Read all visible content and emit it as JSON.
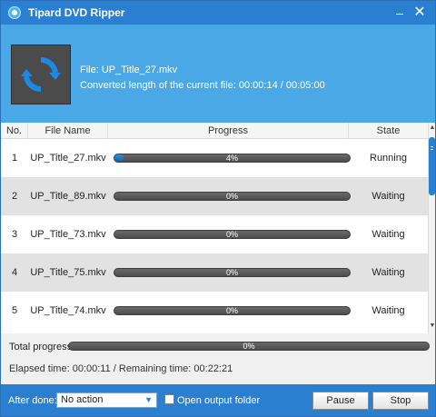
{
  "window": {
    "title": "Tipard DVD Ripper"
  },
  "titlebar": {
    "min_glyph": "–",
    "close_glyph": "✕"
  },
  "current": {
    "file_line": "File: UP_Title_27.mkv",
    "length_line": "Converted length of the current file: 00:00:14 / 00:05:00"
  },
  "table": {
    "headers": {
      "no": "No.",
      "name": "File Name",
      "progress": "Progress",
      "state": "State"
    },
    "rows": [
      {
        "no": "1",
        "name": "UP_Title_27.mkv",
        "progress_text": "4%",
        "progress": 0.04,
        "state": "Running"
      },
      {
        "no": "2",
        "name": "UP_Title_89.mkv",
        "progress_text": "0%",
        "progress": 0,
        "state": "Waiting"
      },
      {
        "no": "3",
        "name": "UP_Title_73.mkv",
        "progress_text": "0%",
        "progress": 0,
        "state": "Waiting"
      },
      {
        "no": "4",
        "name": "UP_Title_75.mkv",
        "progress_text": "0%",
        "progress": 0,
        "state": "Waiting"
      },
      {
        "no": "5",
        "name": "UP_Title_74.mkv",
        "progress_text": "0%",
        "progress": 0,
        "state": "Waiting"
      }
    ]
  },
  "total": {
    "label": "Total progress:",
    "progress_text": "0%",
    "elapsed_text": "Elapsed time: 00:00:11 / Remaining time: 00:22:21"
  },
  "bottom": {
    "after_label": "After done:",
    "after_value": "No action",
    "open_folder_label": "Open output folder",
    "open_folder_checked": false,
    "pause_label": "Pause",
    "stop_label": "Stop"
  },
  "colors": {
    "accent": "#2b7fd0",
    "header": "#4aa8e6",
    "progress_fill": "#1f7ad0"
  },
  "icons": {
    "app": "app-logo-icon",
    "convert": "refresh-icon",
    "dropdown": "chevron-down-icon"
  }
}
